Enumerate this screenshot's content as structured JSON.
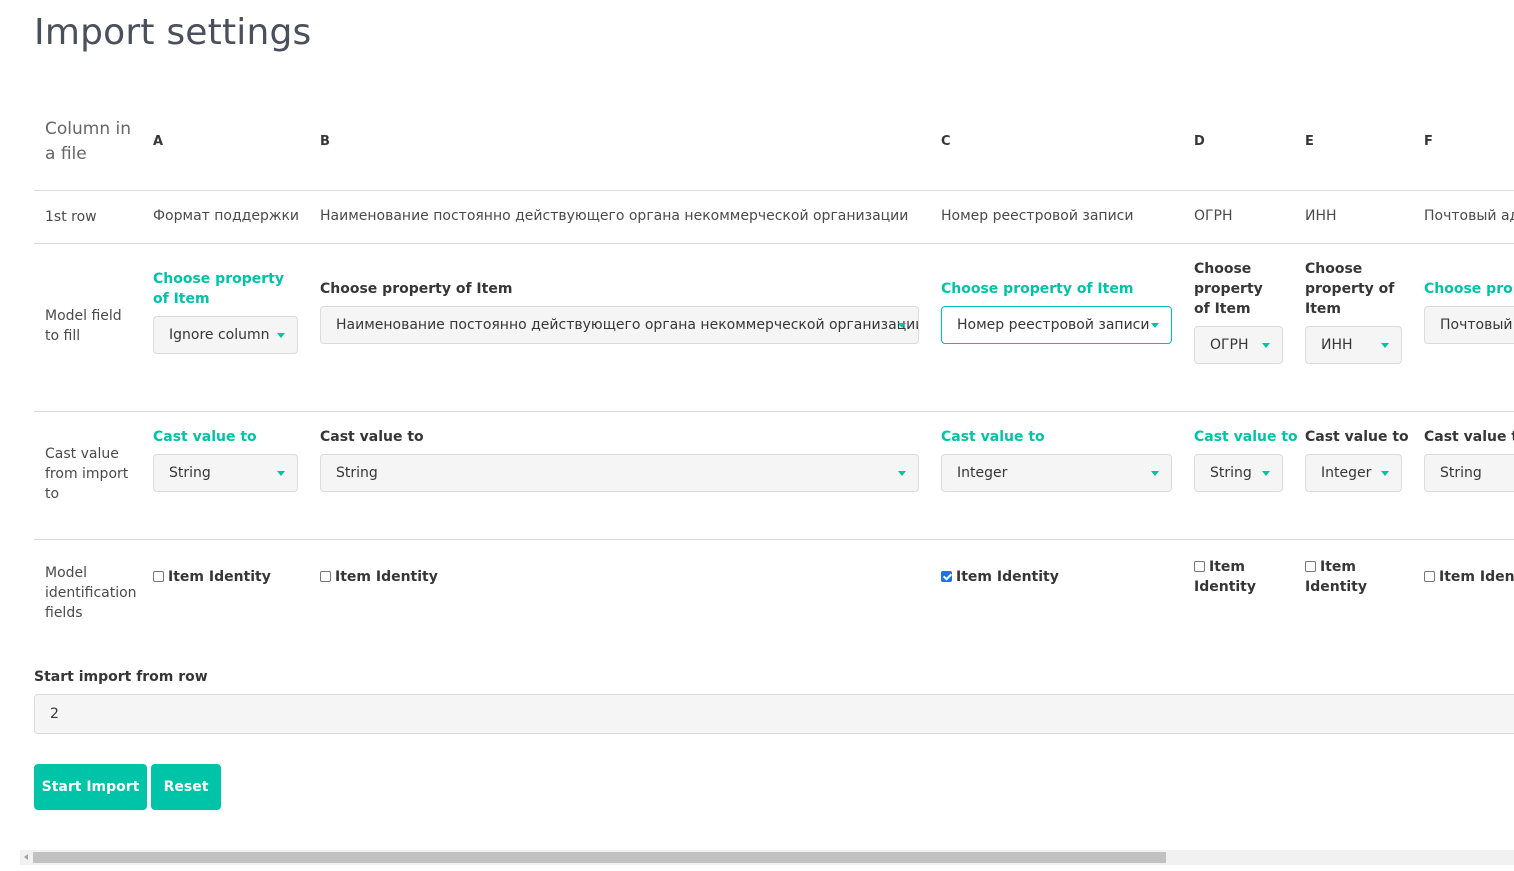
{
  "page_title": "Import settings",
  "row_labels": {
    "column_in_file": "Column in a file",
    "first_row": "1st row",
    "model_field": "Model field to fill",
    "cast_value": "Cast value from import to",
    "identification": "Model identification fields"
  },
  "columns": [
    {
      "letter": "A",
      "first_row": "Формат поддержки",
      "property_label": "Choose property of Item",
      "property_value": "Ignore column",
      "cast_label": "Cast value to",
      "cast_value": "String",
      "identity_label": "Item Identity",
      "identity_checked": false
    },
    {
      "letter": "B",
      "first_row": "Наименование постоянно действующего органа некоммерческой организации",
      "property_label": "Choose property of Item",
      "property_value": "Наименование постоянно действующего органа некоммерческой организации",
      "cast_label": "Cast value to",
      "cast_value": "String",
      "identity_label": "Item Identity",
      "identity_checked": false
    },
    {
      "letter": "C",
      "first_row": "Номер реестровой записи",
      "property_label": "Choose property of Item",
      "property_value": "Номер реестровой записи",
      "cast_label": "Cast value to",
      "cast_value": "Integer",
      "identity_label": "Item Identity",
      "identity_checked": true
    },
    {
      "letter": "D",
      "first_row": "ОГРН",
      "property_label": "Choose property of Item",
      "property_value": "ОГРН",
      "cast_label": "Cast value to",
      "cast_value": "String",
      "identity_label": "Item Identity",
      "identity_checked": false
    },
    {
      "letter": "E",
      "first_row": "ИНН",
      "property_label": "Choose property of Item",
      "property_value": "ИНН",
      "cast_label": "Cast value to",
      "cast_value": "Integer",
      "identity_label": "Item Identity",
      "identity_checked": false
    },
    {
      "letter": "F",
      "first_row": "Почтовый ад",
      "property_label": "Choose prope",
      "property_value": "Почтовый",
      "cast_label": "Cast value to",
      "cast_value": "String",
      "identity_label": "Item Identit",
      "identity_checked": false
    }
  ],
  "start_row": {
    "label": "Start import from row",
    "value": "2"
  },
  "buttons": {
    "start": "Start Import",
    "reset": "Reset"
  },
  "colors": {
    "accent": "#00c4a7",
    "checkbox_checked": "#1a73e8"
  }
}
